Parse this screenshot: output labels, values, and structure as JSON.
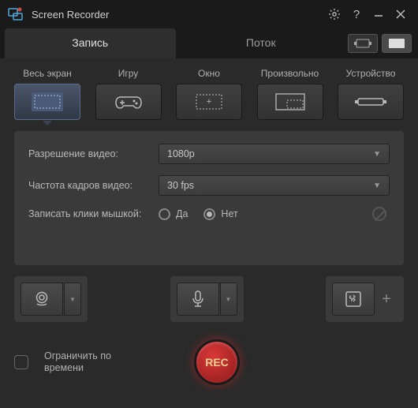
{
  "app": {
    "title": "Screen Recorder"
  },
  "tabs": {
    "record": "Запись",
    "stream": "Поток"
  },
  "capture": {
    "fullscreen": "Весь экран",
    "game": "Игру",
    "window": "Окно",
    "custom": "Произвольно",
    "device": "Устройство"
  },
  "settings": {
    "resolution_label": "Разрешение видео:",
    "resolution_value": "1080p",
    "fps_label": "Частота кадров видео:",
    "fps_value": "30 fps",
    "clicks_label": "Записать клики мышкой:",
    "yes": "Да",
    "no": "Нет"
  },
  "bottom": {
    "limit_label": "Ограничить по времени",
    "rec": "REC"
  }
}
